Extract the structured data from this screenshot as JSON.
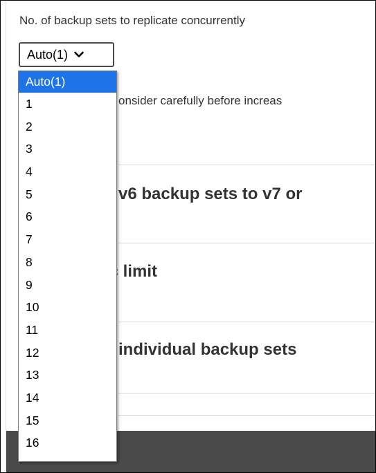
{
  "setting": {
    "label": "No. of backup sets to replicate concurrently",
    "selected": "Auto(1)",
    "note": "onsider carefully before increas"
  },
  "sections": [
    {
      "title": "e v6 backup sets to v7 or"
    },
    {
      "title": "ic limit"
    },
    {
      "title": "e individual backup sets"
    }
  ],
  "dropdown": {
    "options": [
      "Auto(1)",
      "1",
      "2",
      "3",
      "4",
      "5",
      "6",
      "7",
      "8",
      "9",
      "10",
      "11",
      "12",
      "13",
      "14",
      "15",
      "16"
    ]
  }
}
